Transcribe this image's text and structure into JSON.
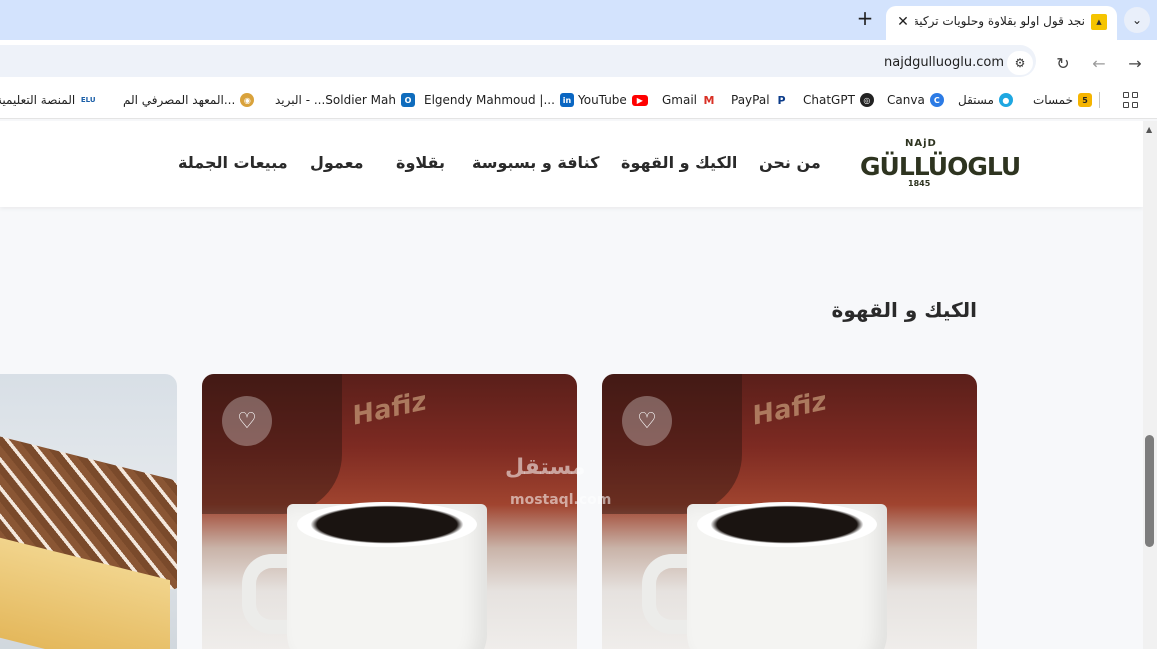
{
  "browser": {
    "tab": {
      "title": "نجد قول اولو بقلاوة وحلويات تركية",
      "favicon": "bee-icon"
    },
    "new_tab_label": "+",
    "close_label": "✕",
    "url": "najdgulluoglu.com"
  },
  "bookmarks": [
    {
      "label": "خمسات",
      "icon": "5",
      "color": "#f5b400"
    },
    {
      "label": "مستقل",
      "icon": "●",
      "color": "#1ea7e1"
    },
    {
      "label": "Canva",
      "icon": "C",
      "color": "#2c7be5"
    },
    {
      "label": "ChatGPT",
      "icon": "◎",
      "color": "#222222"
    },
    {
      "label": "PayPal",
      "icon": "P",
      "color": "#0c3c8a"
    },
    {
      "label": "Gmail",
      "icon": "M",
      "color": "#d93025"
    },
    {
      "label": "YouTube",
      "icon": "▶",
      "color": "#ff0000"
    },
    {
      "label": "Elgendy Mahmoud |...",
      "icon": "in",
      "color": "#0a66c2"
    },
    {
      "label": "البريد - ...Soldier Mah",
      "icon": "O",
      "color": "#0f6cbd"
    },
    {
      "label": "المعهد المصرفي الم...",
      "icon": "◉",
      "color": "#d9a23b"
    },
    {
      "label": "المنصة التعليمية",
      "icon": "ELU",
      "color": "#1b5fa8"
    }
  ],
  "site": {
    "logo": {
      "top": "NAjD",
      "brand": "GÜLLÜOGLU",
      "year": "1845"
    },
    "nav": [
      "من نحن",
      "الكيك و القهوة",
      "كنافة و بسبوسة",
      "بقلاوة",
      "معمول",
      "مبيعات الجملة"
    ],
    "section_title": "الكيك و القهوة",
    "watermark": "مستقل",
    "watermark_url": "mostaql.com"
  }
}
